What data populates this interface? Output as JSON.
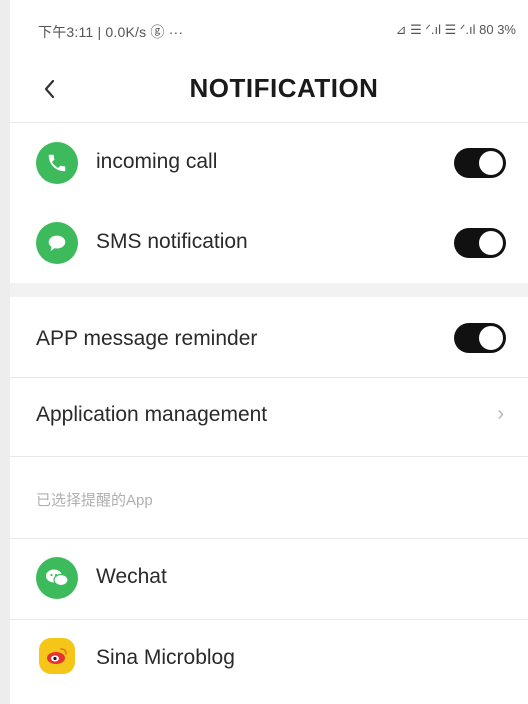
{
  "status_bar": {
    "left_text": "下午3:11 | 0.0K/s ⓖ ···",
    "right_text": "⊿ ☰ ᐟ.ıl ☰ ᐟ.ıl 80 3%"
  },
  "header": {
    "title": "NOTIFICATION",
    "back_icon": "chevron-left-icon"
  },
  "call_settings": [
    {
      "label": "incoming call",
      "icon": "phone-icon",
      "icon_color": "#3dbb5c",
      "enabled": true
    },
    {
      "label": "SMS notification",
      "icon": "message-icon",
      "icon_color": "#3dbb5c",
      "enabled": true
    }
  ],
  "app_settings": {
    "reminder_label": "APP message reminder",
    "reminder_enabled": true,
    "management_label": "Application management",
    "management_chevron": "›"
  },
  "selected_apps_caption": "已选择提醒的App",
  "selected_apps": [
    {
      "label": "Wechat",
      "icon": "wechat-icon",
      "icon_color": "#3dbb5c"
    },
    {
      "label": "Sina Microblog",
      "icon": "weibo-icon",
      "icon_color": "#f5c518"
    }
  ],
  "colors": {
    "toggle_on": "#111111",
    "green_icon": "#3dbb5c",
    "divider": "#e8e8e8",
    "section_gap": "#f2f2f2"
  }
}
